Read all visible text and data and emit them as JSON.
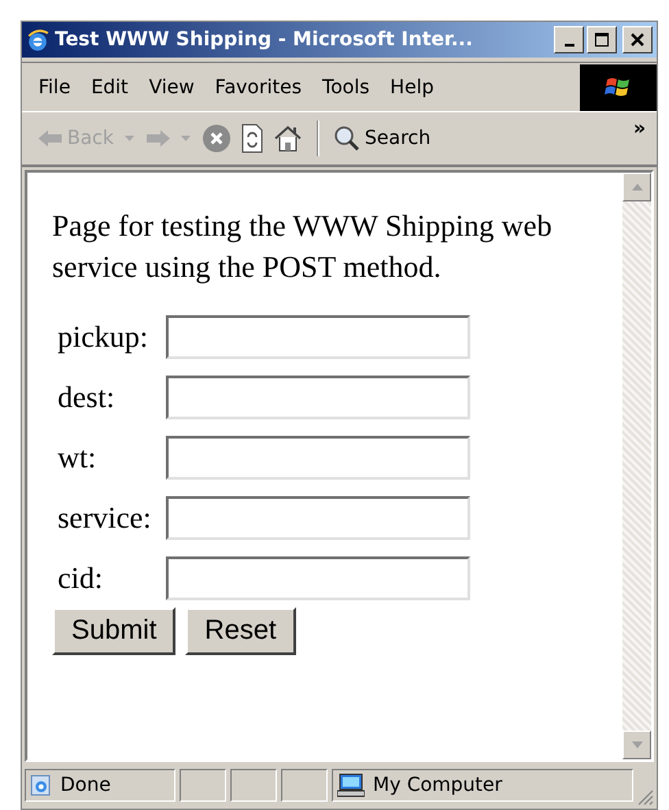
{
  "window": {
    "title": "Test WWW Shipping - Microsoft Inter..."
  },
  "menu": [
    {
      "label": "File"
    },
    {
      "label": "Edit"
    },
    {
      "label": "View"
    },
    {
      "label": "Favorites"
    },
    {
      "label": "Tools"
    },
    {
      "label": "Help"
    }
  ],
  "toolbar": {
    "back": {
      "label": "Back",
      "disabled": true
    },
    "search": {
      "label": "Search"
    },
    "more": "»"
  },
  "page": {
    "intro": "Page for testing the WWW Shipping web service using the POST method.",
    "fields": [
      {
        "label": "pickup:"
      },
      {
        "label": "dest:"
      },
      {
        "label": "wt:"
      },
      {
        "label": "service:"
      },
      {
        "label": "cid:"
      }
    ],
    "buttons": [
      {
        "label": "Submit"
      },
      {
        "label": "Reset"
      }
    ]
  },
  "status_bar": {
    "status": "Done",
    "zone": "My Computer"
  }
}
